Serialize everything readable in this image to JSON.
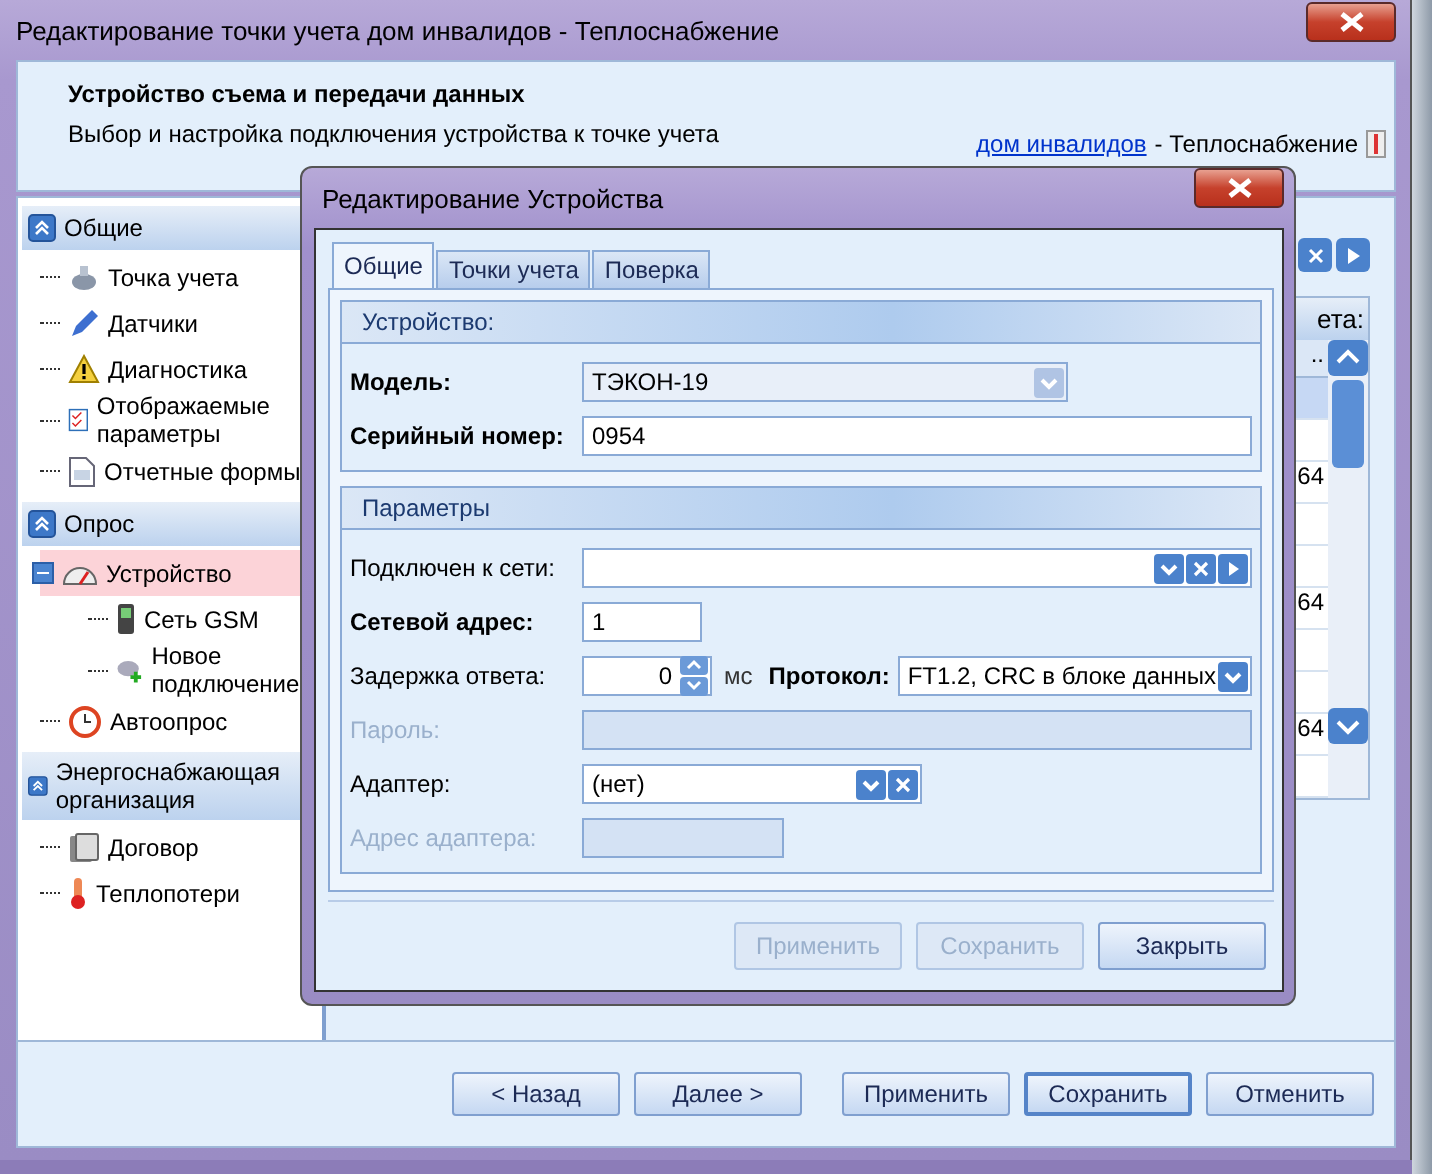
{
  "window": {
    "title": "Редактирование точки учета дом инвалидов - Теплоснабжение"
  },
  "header": {
    "title": "Устройство съема и передачи данных",
    "subtitle": "Выбор и настройка подключения устройства к точке учета",
    "breadcrumb_link": "дом инвалидов",
    "breadcrumb_text": "- Теплоснабжение"
  },
  "sidebar": {
    "groups": [
      {
        "title": "Общие",
        "items": [
          {
            "label": "Точка учета",
            "selected": false
          },
          {
            "label": "Датчики",
            "selected": false
          },
          {
            "label": "Диагностика",
            "selected": false
          },
          {
            "label": "Отображаемые параметры",
            "selected": false
          },
          {
            "label": "Отчетные формы",
            "selected": false
          }
        ]
      },
      {
        "title": "Опрос",
        "items": [
          {
            "label": "Устройство",
            "selected": true,
            "expanded": true,
            "children": [
              {
                "label": "Сеть GSM",
                "selected": false
              },
              {
                "label": "Новое подключение",
                "selected": false
              }
            ]
          },
          {
            "label": "Автоопрос",
            "selected": false
          }
        ]
      },
      {
        "title": "Энергоснабжающая организация",
        "items": [
          {
            "label": "Договор",
            "selected": false
          },
          {
            "label": "Теплопотери",
            "selected": false
          }
        ]
      }
    ]
  },
  "background_grid": {
    "header": "ета:",
    "column": "..",
    "cells": [
      "64",
      "64",
      "64"
    ]
  },
  "dialog": {
    "title": "Редактирование Устройства",
    "tabs": [
      {
        "label": "Общие",
        "selected": true
      },
      {
        "label": "Точки учета",
        "selected": false
      },
      {
        "label": "Поверка",
        "selected": false
      }
    ],
    "device_section": {
      "title": "Устройство:",
      "model_label": "Модель:",
      "model_value": "ТЭКОН-19",
      "serial_label": "Серийный номер:",
      "serial_value": "0954"
    },
    "params_section": {
      "title": "Параметры",
      "fields": [
        {
          "kind": "combo-nav",
          "label": "Подключен к сети:",
          "required": false,
          "disabled": false
        },
        {
          "kind": "text",
          "label": "Сетевой адрес:",
          "value": "1",
          "required": true,
          "disabled": false
        },
        {
          "kind": "delay",
          "label": "Задержка ответа:",
          "value": "0",
          "unit": "мс",
          "required": false,
          "disabled": false,
          "protocol_label": "Протокол:",
          "protocol_value": "FT1.2, CRC в блоке данных"
        },
        {
          "kind": "wide",
          "label": "Пароль:",
          "required": false,
          "disabled": true
        },
        {
          "kind": "combo-clear",
          "label": "Адаптер:",
          "value": "(нет)",
          "required": false,
          "disabled": false
        },
        {
          "kind": "short",
          "label": "Адрес адаптера:",
          "required": false,
          "disabled": true
        }
      ]
    },
    "buttons": [
      {
        "label": "Применить",
        "disabled": true
      },
      {
        "label": "Сохранить",
        "disabled": true
      },
      {
        "label": "Закрыть",
        "disabled": false
      }
    ]
  },
  "buttons": [
    {
      "label": "< Назад",
      "default": false
    },
    {
      "label": "Далее >",
      "default": false
    },
    {
      "label": "Применить",
      "default": false
    },
    {
      "label": "Сохранить",
      "default": true
    },
    {
      "label": "Отменить",
      "default": false
    }
  ]
}
